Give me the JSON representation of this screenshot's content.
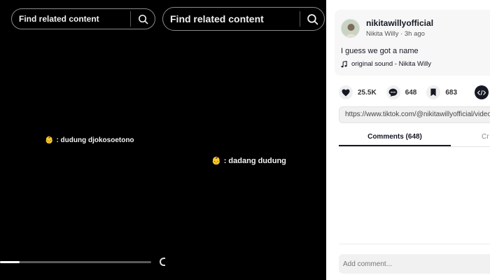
{
  "video_left": {
    "search_placeholder": "Find related content",
    "caption_emoji": "👶",
    "caption": ": dudung djokosoetono",
    "progress": 0.13
  },
  "video_right": {
    "search_placeholder": "Find related content",
    "caption_emoji": "👶",
    "caption": ": dadang dudung"
  },
  "post": {
    "username": "nikitawillyofficial",
    "meta": "Nikita Willy · 3h ago",
    "description": "I guess we got a name",
    "sound": "original sound - Nikita Willy",
    "likes": "25.5K",
    "comments": "648",
    "saves": "683",
    "link": "https://www.tiktok.com/@nikitawillyofficial/video"
  },
  "tabs": {
    "comments_label": "Comments (648)",
    "creator_label": "Cr"
  },
  "comment_input": {
    "placeholder": "Add comment..."
  }
}
